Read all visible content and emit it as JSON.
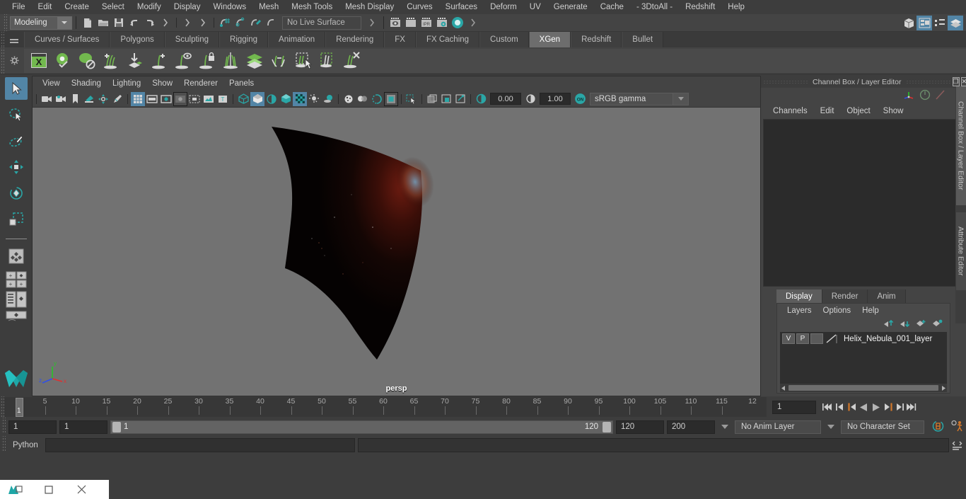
{
  "app": {
    "title": "Autodesk Maya",
    "accent": "#5285a6",
    "xgen_green": "#7bbd5a",
    "orange": "#d1772a",
    "teal": "#2aa6a6"
  },
  "menubar": {
    "items": [
      "File",
      "Edit",
      "Create",
      "Select",
      "Modify",
      "Display",
      "Windows",
      "Mesh",
      "Mesh Tools",
      "Mesh Display",
      "Curves",
      "Surfaces",
      "Deform",
      "UV",
      "Generate",
      "Cache",
      "- 3DtoAll -",
      "Redshift",
      "Help"
    ]
  },
  "statusbar": {
    "menu_set": "Modeling",
    "live_surface": "No Live Surface",
    "icons": [
      "new-scene-icon",
      "open-scene-icon",
      "save-scene-icon",
      "undo-icon",
      "redo-icon",
      "select-by-hierarchy-icon",
      "select-by-object-icon",
      "select-by-component-icon",
      "snap-to-grid-icon",
      "snap-to-curve-icon",
      "snap-to-point-icon",
      "snap-to-projected-center-icon",
      "render-view-icon",
      "render-sequence-icon",
      "ipr-render-icon",
      "render-settings-icon",
      "hypershade-icon"
    ],
    "right_icons": [
      "show-hide-modeling-toolkit-icon",
      "show-hide-attribute-editor-icon",
      "show-hide-tool-settings-icon",
      "show-hide-channel-box-icon"
    ]
  },
  "shelf": {
    "tabs": [
      "Curves / Surfaces",
      "Polygons",
      "Sculpting",
      "Rigging",
      "Animation",
      "Rendering",
      "FX",
      "FX Caching",
      "Custom",
      "XGen",
      "Redshift",
      "Bullet"
    ],
    "active_tab": "XGen",
    "icons": [
      "xgen-editor-icon",
      "xgen-preview-icon",
      "xgen-no-preview-icon",
      "xgen-add-description-icon",
      "xgen-import-collection-icon",
      "xgen-add-guide-icon",
      "xgen-guide-visibility-icon",
      "xgen-lock-guide-icon",
      "xgen-mirror-guide-icon",
      "xgen-sculpt-layers-icon",
      "xgen-convert-icon",
      "xgen-select-guides-icon",
      "xgen-select-region-icon",
      "xgen-delete-guide-icon"
    ]
  },
  "toolbox": {
    "tools": [
      "select-tool",
      "lasso-select-tool",
      "paint-select-tool",
      "move-tool",
      "rotate-tool",
      "scale-tool"
    ],
    "selected": "select-tool",
    "layout_buttons": [
      "single-perspective-view-icon",
      "four-view-layout-icon",
      "outliner-persp-layout-icon",
      "hypergraph-persp-layout-icon"
    ],
    "logo": "maya-logo-icon"
  },
  "viewport": {
    "menus": [
      "View",
      "Shading",
      "Lighting",
      "Show",
      "Renderer",
      "Panels"
    ],
    "camera_label": "persp",
    "exposure_value": "0.00",
    "gamma_value": "1.00",
    "color_management": "sRGB gamma",
    "toolbar_icons": [
      "select-camera-icon",
      "camera-attributes-icon",
      "bookmark-icon",
      "image-plane-icon",
      "two-d-pan-zoom-icon",
      "grease-pencil-icon",
      "grid-toggle-icon",
      "film-gate-icon",
      "resolution-gate-icon",
      "gate-mask-icon",
      "film-origin-icon",
      "safe-action-icon",
      "hud-toggle-icon",
      "wireframe-icon",
      "smooth-shade-all-icon",
      "shaded-wireframe-icon",
      "use-default-material-icon",
      "texture-toggle-icon",
      "lighting-toggle-icon",
      "shadows-icon",
      "screen-space-ao-icon",
      "motion-blur-icon",
      "multisample-aa-icon",
      "depth-of-field-icon",
      "isolate-select-icon",
      "xray-icon",
      "xray-joints-icon",
      "xray-active-components-icon",
      "exposure-icon",
      "gamma-icon",
      "color-management-toggle-icon"
    ],
    "axis_labels": [
      "x",
      "y",
      "z"
    ]
  },
  "channel_box": {
    "panel_title": "Channel Box / Layer Editor",
    "menus": [
      "Channels",
      "Edit",
      "Object",
      "Show"
    ],
    "window_buttons": [
      "restore-panel-icon",
      "close-panel-icon"
    ],
    "header_icons": [
      "axis-gizmo-icon",
      "tool-settings-icon",
      "attribute-editor-icon"
    ],
    "side_tabs": [
      "Channel Box / Layer Editor",
      "Attribute Editor"
    ]
  },
  "layer_editor": {
    "tabs": [
      "Display",
      "Render",
      "Anim"
    ],
    "active_tab": "Display",
    "menus": [
      "Layers",
      "Options",
      "Help"
    ],
    "buttons": [
      "move-layer-up-icon",
      "move-layer-down-icon",
      "create-new-layer-icon",
      "create-layer-from-selected-icon"
    ],
    "layers": [
      {
        "visibility": "V",
        "playback": "P",
        "shading": "",
        "name": "Helix_Nebula_001_layer"
      }
    ]
  },
  "timeline": {
    "current_frame": "1",
    "ticks": [
      5,
      10,
      15,
      20,
      25,
      30,
      35,
      40,
      45,
      50,
      55,
      60,
      65,
      70,
      75,
      80,
      85,
      90,
      95,
      100,
      105,
      110,
      115
    ],
    "partial_last_label": "12",
    "frame_field": "1",
    "playback_buttons": [
      "go-to-start-icon",
      "step-back-keyframe-icon",
      "step-back-frame-icon",
      "play-backwards-icon",
      "play-forwards-icon",
      "step-forward-frame-icon",
      "step-forward-keyframe-icon",
      "go-to-end-icon"
    ]
  },
  "range": {
    "anim_start": "1",
    "range_start": "1",
    "slider_min_label": "1",
    "slider_max_label": "120",
    "range_end": "120",
    "anim_end": "200",
    "anim_layer": "No Anim Layer",
    "character_set": "No Character Set",
    "right_icons": [
      "auto-keyframe-icon",
      "animation-preferences-icon"
    ]
  },
  "command_line": {
    "language": "Python",
    "input_value": "",
    "output_value": "",
    "script_editor_icon": "script-editor-icon"
  },
  "taskbar": {
    "buttons": [
      "app-restore-icon",
      "maximize-icon",
      "close-icon"
    ]
  }
}
